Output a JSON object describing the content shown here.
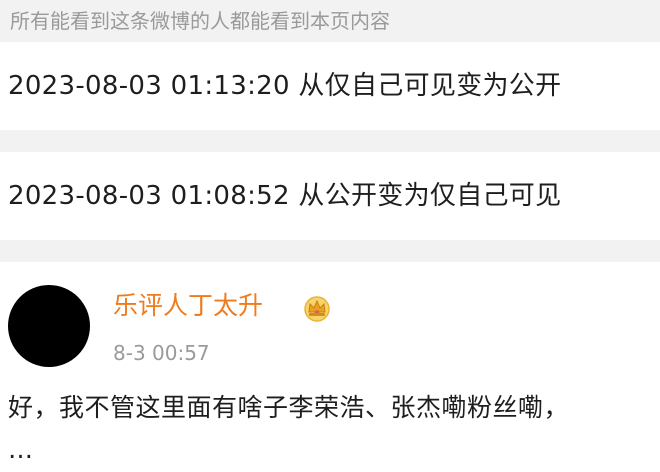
{
  "banner": {
    "text": "所有能看到这条微博的人都能看到本页内容"
  },
  "visibility_log": [
    {
      "text": "2023-08-03 01:13:20 从仅自己可见变为公开"
    },
    {
      "text": "2023-08-03 01:08:52 从公开变为仅自己可见"
    }
  ],
  "comment": {
    "username": "乐评人丁太升",
    "badge_icon": "crown-badge-icon",
    "timestamp": "8-3 00:57",
    "text": "好，我不管这里面有啥子李荣浩、张杰嘞粉丝嘞，",
    "text_next_line": "…"
  },
  "colors": {
    "username": "#f07b1c",
    "meta_gray": "#9a9a9a",
    "separator": "#f2f2f2",
    "badge_gold": "#e8b637"
  }
}
